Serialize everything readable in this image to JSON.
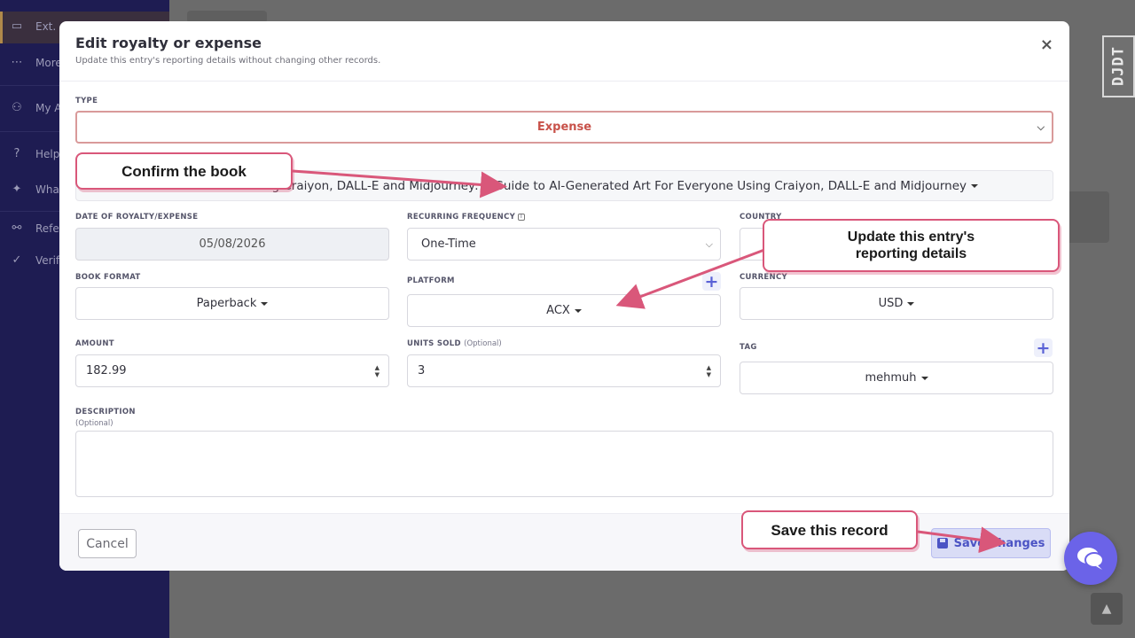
{
  "sidebar": {
    "items": [
      {
        "label": "Ext.",
        "icon": "wallet-icon"
      },
      {
        "label": "More",
        "icon": "more-icon"
      },
      {
        "label": "My A",
        "icon": "user-settings-icon"
      },
      {
        "label": "Help",
        "icon": "help-icon"
      },
      {
        "label": "What",
        "icon": "sparkle-icon"
      },
      {
        "label": "Refer",
        "icon": "users-icon"
      },
      {
        "label": "Verif",
        "icon": "verified-icon"
      }
    ]
  },
  "watermark": "DJDT",
  "modal": {
    "title": "Edit royalty or expense",
    "subtitle": "Update this entry's reporting details without changing other records.",
    "close": "×",
    "type": {
      "label": "TYPE",
      "value": "Expense"
    },
    "book": {
      "value": "AI Art Made Easy: A Beginner's Guide to AI-Generated Art Using Craiyon, DALL-E and Midjourney: A Guide to AI-Generated Art For Everyone Using Craiyon, DALL-E and Midjourney",
      "visible_value": "ng Craiyon, DALL-E and Midjourney: A Guide to AI-Generated Art For Everyone Using Craiyon, DALL-E and Midjourney"
    },
    "date": {
      "label": "DATE OF ROYALTY/EXPENSE",
      "value": "05/08/2026"
    },
    "frequency": {
      "label": "RECURRING FREQUENCY",
      "value": "One-Time"
    },
    "country": {
      "label": "COUNTRY",
      "value": ""
    },
    "book_format": {
      "label": "BOOK FORMAT",
      "value": "Paperback"
    },
    "platform": {
      "label": "PLATFORM",
      "value": "ACX"
    },
    "currency": {
      "label": "CURRENCY",
      "value": "USD"
    },
    "amount": {
      "label": "AMOUNT",
      "value": "182.99"
    },
    "units_sold": {
      "label": "UNITS SOLD",
      "optional": "(Optional)",
      "value": "3"
    },
    "tag": {
      "label": "TAG",
      "value": "mehmuh"
    },
    "description": {
      "label": "DESCRIPTION",
      "optional": "(Optional)",
      "value": ""
    },
    "cancel_label": "Cancel",
    "save_label": "Save Changes"
  },
  "annotations": {
    "confirm_book": "Confirm the book",
    "update_details_line1": "Update this entry's",
    "update_details_line2": "reporting details",
    "save_record": "Save this record",
    "accent_color": "#d9577a"
  },
  "colors": {
    "sidebar": "#1e1c52",
    "expense_text": "#c8524a",
    "primary": "#5a62d6"
  }
}
